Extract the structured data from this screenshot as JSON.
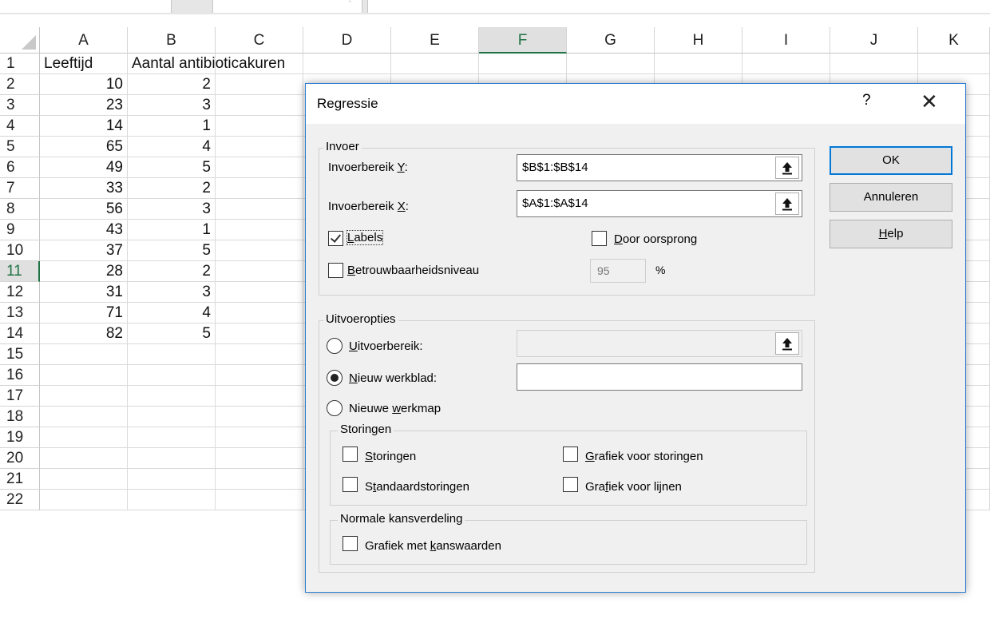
{
  "spreadsheet": {
    "columns": [
      "A",
      "B",
      "C",
      "D",
      "E",
      "F",
      "G",
      "H",
      "I",
      "J",
      "K"
    ],
    "selected_column": "F",
    "selected_row": 11,
    "rows": [
      1,
      2,
      3,
      4,
      5,
      6,
      7,
      8,
      9,
      10,
      11,
      12,
      13,
      14,
      15,
      16,
      17,
      18,
      19,
      20,
      21,
      22
    ],
    "header_a": "Leeftijd",
    "header_b": "Aantal antibioticakuren",
    "data": [
      {
        "a": "10",
        "b": "2"
      },
      {
        "a": "23",
        "b": "3"
      },
      {
        "a": "14",
        "b": "1"
      },
      {
        "a": "65",
        "b": "4"
      },
      {
        "a": "49",
        "b": "5"
      },
      {
        "a": "33",
        "b": "2"
      },
      {
        "a": "56",
        "b": "3"
      },
      {
        "a": "43",
        "b": "1"
      },
      {
        "a": "37",
        "b": "5"
      },
      {
        "a": "28",
        "b": "2"
      },
      {
        "a": "31",
        "b": "3"
      },
      {
        "a": "71",
        "b": "4"
      },
      {
        "a": "82",
        "b": "5"
      }
    ],
    "accent_color": "#217346"
  },
  "dialog": {
    "title": "Regressie",
    "help_glyph": "?",
    "close_glyph": "✕",
    "accent_color": "#0078d7",
    "input_group": {
      "title": "Invoer",
      "y_label_pre": "Invoerbereik ",
      "y_label_key": "Y",
      "y_label_post": ":",
      "y_value": "$B$1:$B$14",
      "x_label_pre": "Invoerbereik ",
      "x_label_key": "X",
      "x_label_post": ":",
      "x_value": "$A$1:$A$14",
      "labels_key": "L",
      "labels_rest": "abels",
      "labels_checked": true,
      "origin_key": "D",
      "origin_rest": "oor oorsprong",
      "origin_checked": false,
      "confidence_key": "B",
      "confidence_rest": "etrouwbaarheidsniveau",
      "confidence_checked": false,
      "confidence_value": "95",
      "percent": "%"
    },
    "output_group": {
      "title": "Uitvoeropties",
      "range_key": "U",
      "range_rest": "itvoerbereik:",
      "range_selected": false,
      "range_value": "",
      "sheet_key": "N",
      "sheet_rest": "ieuw werkblad:",
      "sheet_selected": true,
      "sheet_value": "",
      "workbook_pre": "Nieuwe ",
      "workbook_key": "w",
      "workbook_rest": "erkmap",
      "workbook_selected": false
    },
    "residuals_group": {
      "title": "Storingen",
      "residuals_key": "S",
      "residuals_rest": "toringen",
      "std_pre": "S",
      "std_key": "t",
      "std_rest": "andaardstoringen",
      "resplot_key": "G",
      "resplot_rest": "rafiek voor storingen",
      "lineplot_pre": "Gra",
      "lineplot_key": "f",
      "lineplot_rest": "iek voor lijnen"
    },
    "normal_group": {
      "title": "Normale kansverdeling",
      "prob_pre": "Grafiek met ",
      "prob_key": "k",
      "prob_rest": "answaarden"
    },
    "buttons": {
      "ok": "OK",
      "cancel": "Annuleren",
      "help_key": "H",
      "help_rest": "elp"
    }
  }
}
